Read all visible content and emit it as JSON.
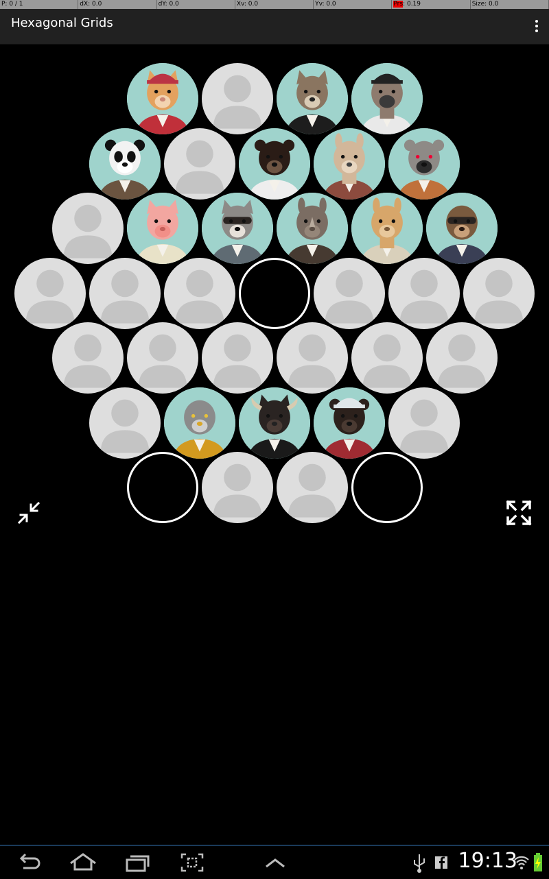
{
  "debug": {
    "p": "P: 0 / 1",
    "dx": "dX: 0.0",
    "dy": "dY: 0.0",
    "xv": "Xv: 0.0",
    "yv": "Yv: 0.0",
    "prs_key": "Prs",
    "prs_val": ": 0.19",
    "size": "Size: 0.0"
  },
  "app": {
    "title": "Hexagonal Grids"
  },
  "grid": {
    "rows": [
      [
        "cat",
        "placeholder",
        "wolf",
        "ostrich"
      ],
      [
        "panda",
        "placeholder",
        "bear",
        "llama",
        "lemur"
      ],
      [
        "placeholder",
        "pig",
        "raccoon",
        "rhino",
        "giraffe",
        "sloth"
      ],
      [
        "placeholder",
        "placeholder",
        "placeholder",
        "empty",
        "placeholder",
        "placeholder",
        "placeholder"
      ],
      [
        "placeholder",
        "placeholder",
        "placeholder",
        "placeholder",
        "placeholder",
        "placeholder"
      ],
      [
        "placeholder",
        "owl",
        "bull",
        "monkey",
        "placeholder"
      ],
      [
        "empty",
        "placeholder",
        "placeholder",
        "empty"
      ]
    ]
  },
  "icons": {
    "collapse": "collapse-arrows-icon",
    "expand": "expand-arrows-icon",
    "overflow": "overflow-menu-icon"
  },
  "status_bar": {
    "time": "19:13"
  },
  "colors": {
    "action_bar": "#212121",
    "placeholder_bg": "#dedede",
    "placeholder_fg": "#c4c4c4",
    "animal_bg": "#9fd3cc"
  }
}
